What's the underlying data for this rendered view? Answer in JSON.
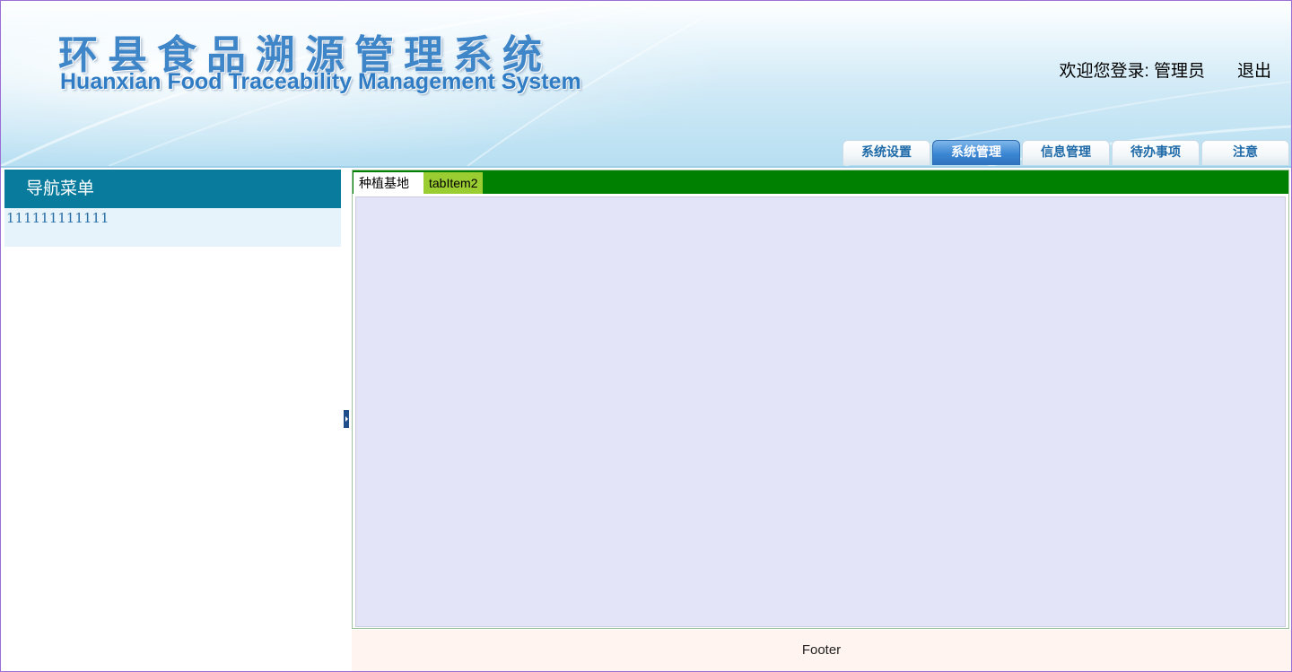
{
  "header": {
    "title_cn": "环县食品溯源管理系统",
    "title_en": "Huanxian Food Traceability Management System",
    "welcome": "欢迎您登录: 管理员",
    "logout": "退出",
    "nav_tabs": [
      {
        "label": "系统设置",
        "active": false
      },
      {
        "label": "系统管理",
        "active": true
      },
      {
        "label": "信息管理",
        "active": false
      },
      {
        "label": "待办事项",
        "active": false
      },
      {
        "label": "注意",
        "active": false
      }
    ]
  },
  "sidebar": {
    "title": "导航菜单",
    "items": [
      {
        "label": "111111111111"
      }
    ]
  },
  "main": {
    "tabs": [
      {
        "label": "种植基地",
        "active": true
      },
      {
        "label": "tabItem2",
        "active": false
      }
    ]
  },
  "footer": {
    "text": "Footer"
  },
  "colors": {
    "sidebar_title_bg": "#097c9e",
    "tabbar_bg": "#008000",
    "tab2_bg": "#9acd32",
    "content_bg": "#e4e4f8",
    "footer_bg": "#fff4ef",
    "nav_active": "#3b86d3"
  },
  "icons": {
    "collapse_handle": "collapse-arrow-icon"
  }
}
